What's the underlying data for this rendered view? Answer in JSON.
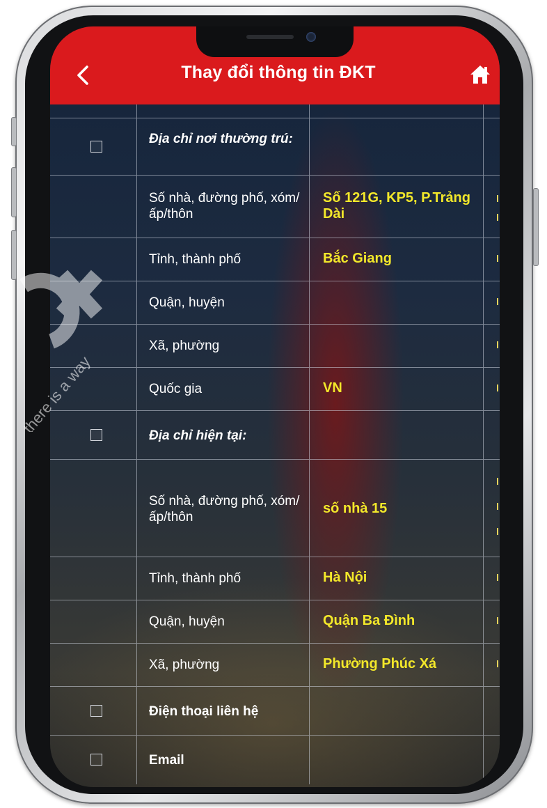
{
  "header": {
    "title": "Thay đổi thông tin ĐKT"
  },
  "icons": {
    "back": "chevron-left-icon",
    "home": "home-icon",
    "checkbox": "checkbox-empty-icon"
  },
  "colors": {
    "header_bg": "#da1a1d",
    "value_text": "#f3e82a",
    "label_text": "#ffffff"
  },
  "rows": {
    "r0": {
      "label": "",
      "value": ""
    },
    "r1": {
      "label": "Địa chỉ nơi thường trú:",
      "value": ""
    },
    "r2": {
      "label": "Số nhà, đường phố, xóm/ấp/thôn",
      "value": "Số 121G, KP5, P.Trảng Dài"
    },
    "r3": {
      "label": "Tỉnh, thành phố",
      "value": "Bắc Giang"
    },
    "r4": {
      "label": "Quận, huyện",
      "value": ""
    },
    "r5": {
      "label": "Xã, phường",
      "value": ""
    },
    "r6": {
      "label": "Quốc gia",
      "value": "VN"
    },
    "r7": {
      "label": "Địa chỉ hiện tại:",
      "value": ""
    },
    "r8": {
      "label": "Số nhà, đường phố, xóm/ấp/thôn",
      "value": "số nhà 15"
    },
    "r9": {
      "label": "Tỉnh, thành phố",
      "value": "Hà Nội"
    },
    "r10": {
      "label": "Quận, huyện",
      "value": "Quận Ba Đình"
    },
    "r11": {
      "label": "Xã, phường",
      "value": "Phường Phúc Xá"
    },
    "r12": {
      "label": "Điện thoại liên hệ",
      "value": ""
    },
    "r13": {
      "label": "Email",
      "value": ""
    }
  },
  "watermark": {
    "text": "there is a way"
  }
}
